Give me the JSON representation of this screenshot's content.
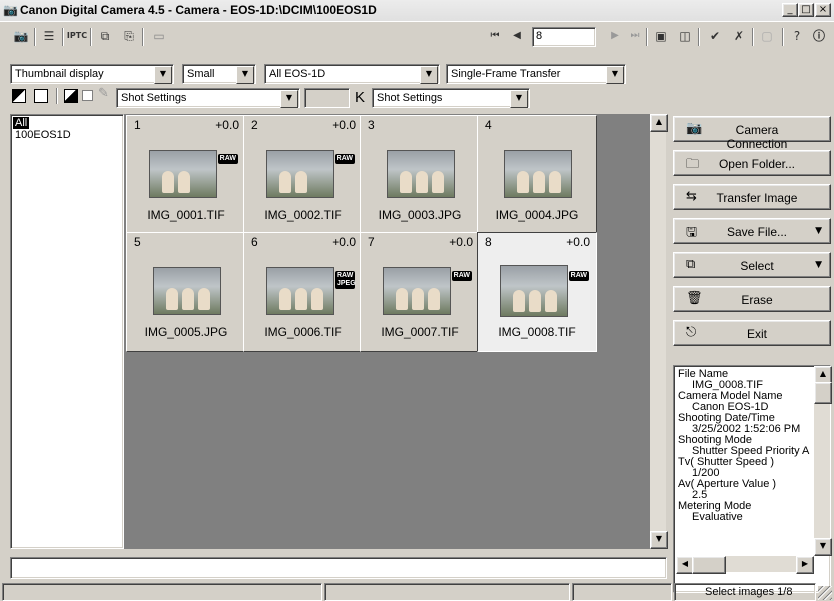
{
  "window": {
    "title": "Canon Digital Camera 4.5 - Camera - EOS-1D:\\DCIM\\100EOS1D",
    "controls": [
      "_",
      "□",
      "×"
    ]
  },
  "toolbar": {
    "iptc_label": "IPTC",
    "frame_value": "8",
    "icons": [
      "camera-settings-icon",
      "properties-icon",
      "iptc-icon",
      "copy-icon",
      "paste-icon",
      "image-icon",
      "first-icon",
      "prev-icon",
      "next-icon",
      "last-icon",
      "view1-icon",
      "view2-icon",
      "check-icon",
      "uncheck-icon",
      "disabled-icon",
      "help-icon",
      "info-icon"
    ]
  },
  "filters": {
    "display_mode": "Thumbnail display",
    "size": "Small",
    "camera_filter": "All EOS-1D",
    "transfer_mode": "Single-Frame Transfer"
  },
  "settings_row": {
    "left_select": "Shot Settings",
    "k_label": "K",
    "right_select": "Shot Settings"
  },
  "tree": {
    "items": [
      "All",
      "100EOS1D"
    ]
  },
  "thumbnails": [
    {
      "num": "1",
      "ev": "+0.0",
      "name": "IMG_0001.TIF",
      "badge": "RAW"
    },
    {
      "num": "2",
      "ev": "+0.0",
      "name": "IMG_0002.TIF",
      "badge": "RAW"
    },
    {
      "num": "3",
      "ev": "",
      "name": "IMG_0003.JPG",
      "badge": ""
    },
    {
      "num": "4",
      "ev": "",
      "name": "IMG_0004.JPG",
      "badge": ""
    },
    {
      "num": "5",
      "ev": "",
      "name": "IMG_0005.JPG",
      "badge": ""
    },
    {
      "num": "6",
      "ev": "+0.0",
      "name": "IMG_0006.TIF",
      "badge": "RAW JPEG"
    },
    {
      "num": "7",
      "ev": "+0.0",
      "name": "IMG_0007.TIF",
      "badge": "RAW"
    },
    {
      "num": "8",
      "ev": "+0.0",
      "name": "IMG_0008.TIF",
      "badge": "RAW"
    }
  ],
  "actions": {
    "camera_connection": "Camera Connection",
    "open_folder": "Open Folder...",
    "transfer_image": "Transfer Image",
    "save_file": "Save File...",
    "select": "Select",
    "erase": "Erase",
    "exit": "Exit"
  },
  "info_panel": {
    "lines": [
      "File Name",
      "   IMG_0008.TIF",
      "Camera Model Name",
      "   Canon EOS-1D",
      "Shooting Date/Time",
      "   3/25/2002 1:52:06 PM",
      "Shooting Mode",
      "   Shutter Speed Priority A",
      "Tv( Shutter Speed )",
      "   1/200",
      "Av( Aperture Value )",
      "   2.5",
      "Metering Mode",
      "   Evaluative"
    ]
  },
  "status": {
    "message": "Select images 1/8"
  }
}
